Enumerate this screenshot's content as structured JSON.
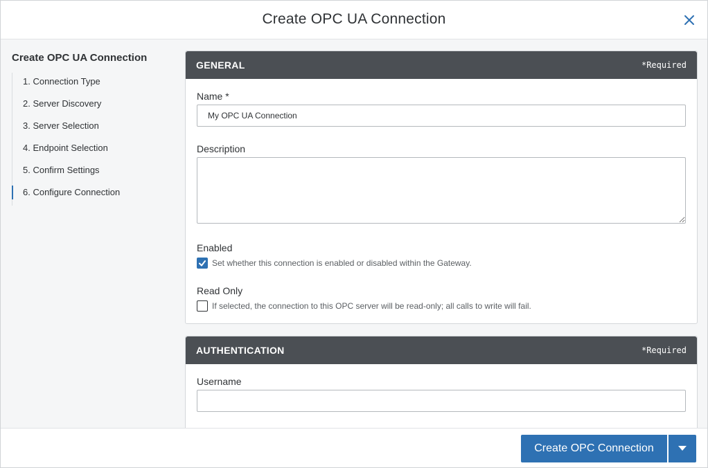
{
  "dialog": {
    "title": "Create OPC UA Connection"
  },
  "sidebar": {
    "title": "Create OPC UA Connection",
    "steps": [
      {
        "label": "1. Connection Type"
      },
      {
        "label": "2. Server Discovery"
      },
      {
        "label": "3. Server Selection"
      },
      {
        "label": "4. Endpoint Selection"
      },
      {
        "label": "5. Confirm Settings"
      },
      {
        "label": "6. Configure Connection"
      }
    ],
    "active_step": "6. Configure Connection"
  },
  "general": {
    "title": "GENERAL",
    "required": "*Required",
    "name_label": "Name *",
    "name_value": "My OPC UA Connection",
    "description_label": "Description",
    "description_value": "",
    "enabled_label": "Enabled",
    "enabled_desc": "Set whether this connection is enabled or disabled within the Gateway.",
    "enabled_checked": true,
    "readonly_label": "Read Only",
    "readonly_desc": "If selected, the connection to this OPC server will be read-only; all calls to write will fail.",
    "readonly_checked": false
  },
  "authentication": {
    "title": "AUTHENTICATION",
    "required": "*Required",
    "username_label": "Username",
    "username_value": ""
  },
  "footer": {
    "create_label": "Create OPC Connection"
  },
  "colors": {
    "accent": "#2e71b3",
    "section_header": "#4b4f54"
  }
}
